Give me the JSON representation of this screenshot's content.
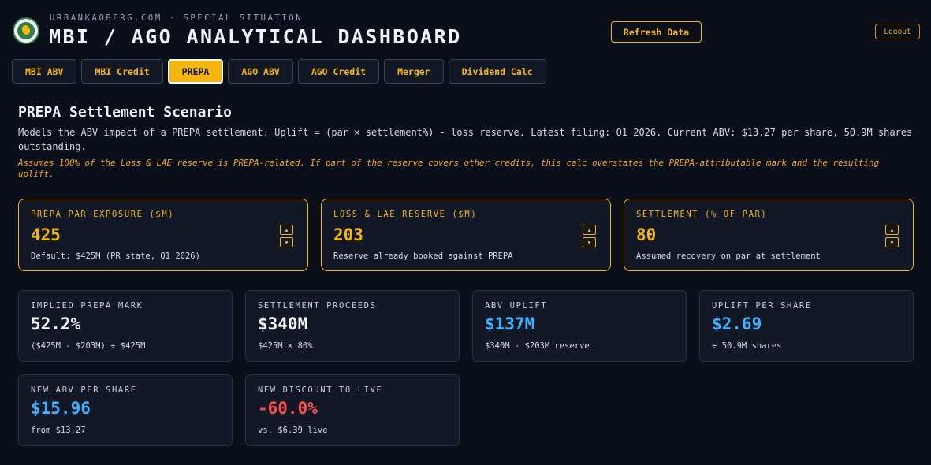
{
  "header": {
    "kicker": "URBANKAOBERG.COM · SPECIAL SITUATION",
    "title": "MBI / AGO ANALYTICAL DASHBOARD",
    "refresh_label": "Refresh Data",
    "logout_label": "Logout"
  },
  "tabs": [
    {
      "label": "MBI ABV"
    },
    {
      "label": "MBI Credit"
    },
    {
      "label": "PREPA"
    },
    {
      "label": "AGO ABV"
    },
    {
      "label": "AGO Credit"
    },
    {
      "label": "Merger"
    },
    {
      "label": "Dividend Calc"
    }
  ],
  "section": {
    "title": "PREPA Settlement Scenario",
    "description": "Models the ABV impact of a PREPA settlement. Uplift = (par × settlement%) - loss reserve. Latest filing: Q1 2026. Current ABV: $13.27 per share, 50.9M shares outstanding.",
    "note": "Assumes 100% of the Loss & LAE reserve is PREPA-related. If part of the reserve covers other credits, this calc overstates the PREPA-attributable mark and the resulting uplift."
  },
  "inputs": [
    {
      "label": "PREPA PAR EXPOSURE ($M)",
      "value": "425",
      "sub": "Default: $425M (PR state, Q1 2026)"
    },
    {
      "label": "LOSS & LAE RESERVE ($M)",
      "value": "203",
      "sub": "Reserve already booked against PREPA"
    },
    {
      "label": "SETTLEMENT (% OF PAR)",
      "value": "80",
      "sub": "Assumed recovery on par at settlement"
    }
  ],
  "stepper": {
    "up": "▲",
    "down": "▼"
  },
  "metrics": [
    {
      "label": "IMPLIED PREPA MARK",
      "value": "52.2%",
      "sub": "($425M - $203M) ÷ $425M",
      "color": "#f4f6fa"
    },
    {
      "label": "SETTLEMENT PROCEEDS",
      "value": "$340M",
      "sub": "$425M × 80%",
      "color": "#f4f6fa"
    },
    {
      "label": "ABV UPLIFT",
      "value": "$137M",
      "sub": "$340M - $203M reserve",
      "color": "#3fb3ff"
    },
    {
      "label": "UPLIFT PER SHARE",
      "value": "$2.69",
      "sub": "÷ 50.9M shares",
      "color": "#3fb3ff"
    },
    {
      "label": "NEW ABV PER SHARE",
      "value": "$15.96",
      "sub": "from $13.27",
      "color": "#3fb3ff"
    },
    {
      "label": "NEW DISCOUNT TO LIVE",
      "value": "-60.0%",
      "sub": "vs. $6.39 live",
      "color": "#ff4d4d"
    }
  ],
  "colors": {
    "accent": "#f5b50f",
    "background": "#0b0f1a",
    "positive": "#3fb3ff",
    "negative": "#ff4d4d"
  }
}
